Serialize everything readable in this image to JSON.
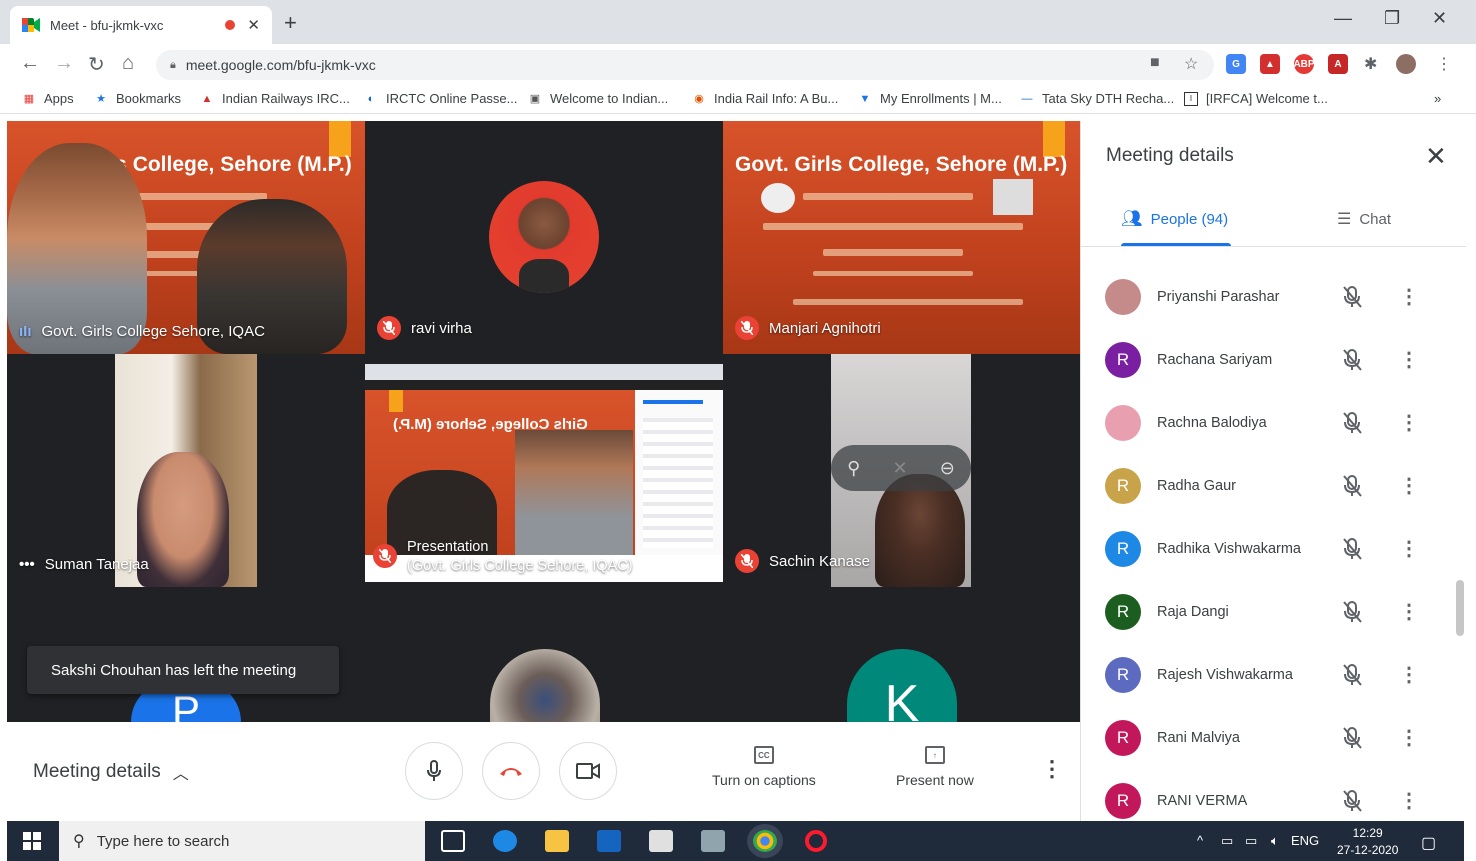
{
  "browser": {
    "tab_title": "Meet - bfu-jkmk-vxc",
    "url": "meet.google.com/bfu-jkmk-vxc",
    "bookmarks": [
      "Apps",
      "Bookmarks",
      "Indian Railways IRC...",
      "IRCTC Online Passe...",
      "Welcome to Indian...",
      "India Rail Info: A Bu...",
      "My Enrollments | M...",
      "Tata Sky DTH Recha...",
      "[IRFCA] Welcome t..."
    ],
    "bookmarks_overflow": "»"
  },
  "tiles": {
    "t1": {
      "name": "Govt. Girls College Sehore, IQAC",
      "banner_title": "Girls College, Sehore (M.P.)"
    },
    "t2": {
      "name": "ravi virha"
    },
    "t3": {
      "name": "Manjari Agnihotri",
      "banner_title": "Govt. Girls College, Sehore (M.P.)"
    },
    "t4": {
      "name": "Suman Tanejaa"
    },
    "t5": {
      "line1": "Presentation",
      "line2": "(Govt. Girls College Sehore, IQAC)"
    },
    "t6": {
      "name": "Sachin Kanase"
    },
    "b1_letter": "P",
    "b3_letter": "K"
  },
  "toast": "Sakshi Chouhan has left the meeting",
  "bottombar": {
    "meeting_details": "Meeting details",
    "captions": "Turn on captions",
    "present": "Present now"
  },
  "panel": {
    "title": "Meeting details",
    "people_tab": "People (94)",
    "chat_tab": "Chat",
    "participants": [
      {
        "name": "Priyanshi Parashar",
        "initial": "",
        "color": "#c58a8a"
      },
      {
        "name": "Rachana Sariyam",
        "initial": "R",
        "color": "#7b1fa2"
      },
      {
        "name": "Rachna Balodiya",
        "initial": "",
        "color": "#e8a0b0"
      },
      {
        "name": "Radha Gaur",
        "initial": "R",
        "color": "#c9a34a"
      },
      {
        "name": "Radhika Vishwakarma",
        "initial": "R",
        "color": "#1e88e5"
      },
      {
        "name": "Raja Dangi",
        "initial": "R",
        "color": "#1b5e20"
      },
      {
        "name": "Rajesh Vishwakarma",
        "initial": "R",
        "color": "#5c6bc0"
      },
      {
        "name": "Rani Malviya",
        "initial": "R",
        "color": "#c2185b"
      },
      {
        "name": "RANI VERMA",
        "initial": "R",
        "color": "#c2185b"
      }
    ]
  },
  "taskbar": {
    "search_placeholder": "Type here to search",
    "lang": "ENG",
    "time": "12:29",
    "date": "27-12-2020"
  },
  "colors": {
    "meet_bg": "#202124",
    "accent_blue": "#1a73e8",
    "end_call_red": "#ea4335"
  }
}
